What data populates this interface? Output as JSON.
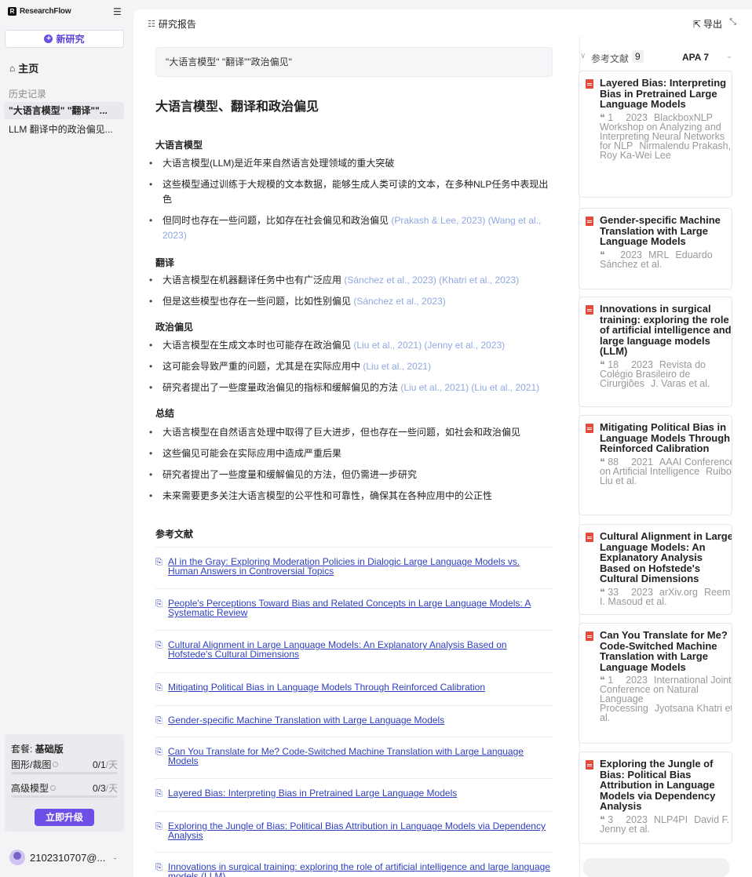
{
  "sidebar": {
    "brand": "ResearchFlow",
    "brand_logo": "R",
    "new_research": "新研究",
    "home": "主页",
    "history_title": "历史记录",
    "history": [
      "\"大语言模型\" \"翻译\"\"...",
      "LLM 翻译中的政治偏见..."
    ],
    "plan": {
      "label": "套餐:",
      "name": "基础版",
      "quotas": [
        {
          "label": "图形/裁图",
          "used": "0",
          "total": "/1",
          "unit": "/天",
          "fraction": 0
        },
        {
          "label": "高级模型",
          "used": "0",
          "total": "/3",
          "unit": "/天",
          "fraction": 0
        }
      ],
      "upgrade": "立即升级"
    },
    "user": "2102310707@...",
    "user_more": "-"
  },
  "header": {
    "report": "研究报告",
    "export": "导出"
  },
  "report": {
    "query": "\"大语言模型\" \"翻译\"\"政治偏见\"",
    "title": "大语言模型、翻译和政治偏见",
    "sections": [
      {
        "heading": "大语言模型",
        "bullets": [
          {
            "text": "大语言模型(LLM)是近年来自然语言处理领域的重大突破",
            "cite": ""
          },
          {
            "text": "这些模型通过训练于大规模的文本数据，能够生成人类可读的文本，在多种NLP任务中表现出色",
            "cite": ""
          },
          {
            "text": "但同时也存在一些问题，比如存在社会偏见和政治偏见",
            "cite": "(Prakash & Lee, 2023) (Wang et al., 2023)"
          }
        ]
      },
      {
        "heading": "翻译",
        "bullets": [
          {
            "text": "大语言模型在机器翻译任务中也有广泛应用",
            "cite": "(Sánchez et al., 2023) (Khatri et al., 2023)"
          },
          {
            "text": "但是这些模型也存在一些问题，比如性别偏见",
            "cite": "(Sánchez et al., 2023)"
          }
        ]
      },
      {
        "heading": "政治偏见",
        "bullets": [
          {
            "text": "大语言模型在生成文本时也可能存在政治偏见",
            "cite": "(Liu et al., 2021) (Jenny et al., 2023)"
          },
          {
            "text": "这可能会导致严重的问题，尤其是在实际应用中",
            "cite": "(Liu et al., 2021)"
          },
          {
            "text": "研究者提出了一些度量政治偏见的指标和缓解偏见的方法",
            "cite": "(Liu et al., 2021) (Liu et al., 2021)"
          }
        ]
      },
      {
        "heading": "总结",
        "bullets": [
          {
            "text": "大语言模型在自然语言处理中取得了巨大进步，但也存在一些问题，如社会和政治偏见",
            "cite": ""
          },
          {
            "text": "这些偏见可能会在实际应用中造成严重后果",
            "cite": ""
          },
          {
            "text": "研究者提出了一些度量和缓解偏见的方法，但仍需进一步研究",
            "cite": ""
          },
          {
            "text": "未来需要更多关注大语言模型的公平性和可靠性，确保其在各种应用中的公正性",
            "cite": ""
          }
        ]
      }
    ],
    "refs_title": "参考文献",
    "refs": [
      "AI in the Gray: Exploring Moderation Policies in Dialogic Large Language Models vs. Human Answers in Controversial Topics",
      "People's Perceptions Toward Bias and Related Concepts in Large Language Models: A Systematic Review",
      "Cultural Alignment in Large Language Models: An Explanatory Analysis Based on Hofstede's Cultural Dimensions",
      "Mitigating Political Bias in Language Models Through Reinforced Calibration",
      "Gender-specific Machine Translation with Large Language Models",
      "Can You Translate for Me? Code-Switched Machine Translation with Large Language Models",
      "Layered Bias: Interpreting Bias in Pretrained Large Language Models",
      "Exploring the Jungle of Bias: Political Bias Attribution in Language Models via Dependency Analysis",
      "Innovations in surgical training: exploring the role of artificial intelligence and large language models (LLM)"
    ]
  },
  "references_panel": {
    "title": "参考文献",
    "count": "9",
    "style": "APA 7",
    "cards": [
      {
        "title": "Layered Bias: Interpreting Bias in Pretrained Large Language Models",
        "cites": "1",
        "year": "2023",
        "venue": "BlackboxNLP Workshop on Analyzing and Interpreting Neural Networks for NLP",
        "authors": "Nirmalendu Prakash, Roy Ka-Wei Lee"
      },
      {
        "title": "Gender-specific Machine Translation with Large Language Models",
        "cites": "",
        "year": "2023",
        "venue": "MRL",
        "authors": "Eduardo Sánchez et al."
      },
      {
        "title": "Innovations in surgical training: exploring the role of artificial intelligence and large language models (LLM)",
        "cites": "18",
        "year": "2023",
        "venue": "Revista do Colégio Brasileiro de Cirurgiões",
        "authors": "J. Varas et al."
      },
      {
        "title": "Mitigating Political Bias in Language Models Through Reinforced Calibration",
        "cites": "88",
        "year": "2021",
        "venue": "AAAI Conference on Artificial Intelligence",
        "authors": "Ruibo Liu et al."
      },
      {
        "title": "Cultural Alignment in Large Language Models: An Explanatory Analysis Based on Hofstede's Cultural Dimensions",
        "cites": "33",
        "year": "2023",
        "venue": "arXiv.org",
        "authors": "Reem I. Masoud et al."
      },
      {
        "title": "Can You Translate for Me? Code-Switched Machine Translation with Large Language Models",
        "cites": "1",
        "year": "2023",
        "venue": "International Joint Conference on Natural Language Processing",
        "authors": "Jyotsana Khatri et al."
      },
      {
        "title": "Exploring the Jungle of Bias: Political Bias Attribution in Language Models via Dependency Analysis",
        "cites": "3",
        "year": "2023",
        "venue": "NLP4PI",
        "authors": "David F. Jenny et al."
      }
    ]
  },
  "colors": {
    "accent": "#6d4ee6",
    "citation": "#8fa8e0",
    "ref_link": "#2d3fbf",
    "pdf_red": "#e24a3b"
  }
}
